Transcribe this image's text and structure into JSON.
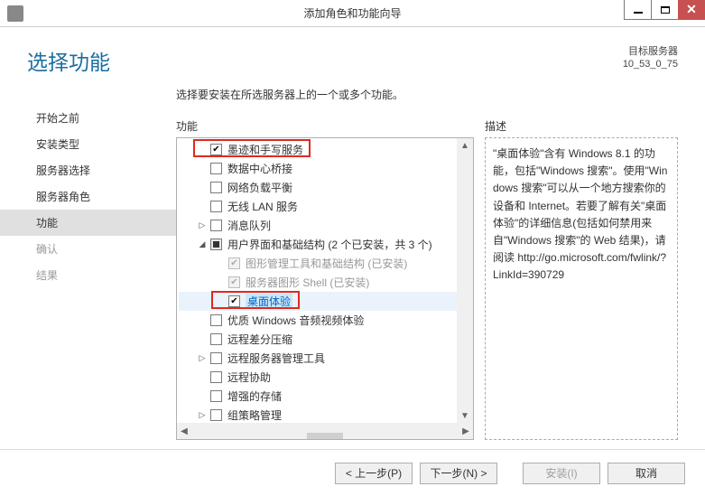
{
  "window": {
    "title": "添加角色和功能向导"
  },
  "header": {
    "title": "选择功能",
    "dest_label": "目标服务器",
    "dest_value": "10_53_0_75"
  },
  "sidebar": {
    "items": [
      {
        "label": "开始之前",
        "active": false,
        "dim": false
      },
      {
        "label": "安装类型",
        "active": false,
        "dim": false
      },
      {
        "label": "服务器选择",
        "active": false,
        "dim": false
      },
      {
        "label": "服务器角色",
        "active": false,
        "dim": false
      },
      {
        "label": "功能",
        "active": true,
        "dim": false
      },
      {
        "label": "确认",
        "active": false,
        "dim": true
      },
      {
        "label": "结果",
        "active": false,
        "dim": true
      }
    ]
  },
  "main": {
    "instruction": "选择要安装在所选服务器上的一个或多个功能。",
    "features_label": "功能",
    "desc_label": "描述",
    "description": "\"桌面体验\"含有 Windows 8.1 的功能，包括\"Windows 搜索\"。使用\"Windows 搜索\"可以从一个地方搜索你的设备和 Internet。若要了解有关\"桌面体验\"的详细信息(包括如何禁用来自\"Windows 搜索\"的 Web 结果)，请阅读 http://go.microsoft.com/fwlink/?LinkId=390729",
    "tree": [
      {
        "label": "墨迹和手写服务",
        "level": 1,
        "checked": true,
        "highlight": true
      },
      {
        "label": "数据中心桥接",
        "level": 1,
        "checked": false
      },
      {
        "label": "网络负载平衡",
        "level": 1,
        "checked": false
      },
      {
        "label": "无线 LAN 服务",
        "level": 1,
        "checked": false
      },
      {
        "label": "消息队列",
        "level": 1,
        "checked": false,
        "expandable": true,
        "expanded": false
      },
      {
        "label": "用户界面和基础结构 (2 个已安装，共 3 个)",
        "level": 1,
        "checked": "partial",
        "expandable": true,
        "expanded": true
      },
      {
        "label": "图形管理工具和基础结构 (已安装)",
        "level": 2,
        "checked": true,
        "disabled": true
      },
      {
        "label": "服务器图形 Shell (已安装)",
        "level": 2,
        "checked": true,
        "disabled": true
      },
      {
        "label": "桌面体验",
        "level": 2,
        "checked": true,
        "selected": true,
        "highlight": true
      },
      {
        "label": "优质 Windows 音频视频体验",
        "level": 1,
        "checked": false
      },
      {
        "label": "远程差分压缩",
        "level": 1,
        "checked": false
      },
      {
        "label": "远程服务器管理工具",
        "level": 1,
        "checked": false,
        "expandable": true,
        "expanded": false
      },
      {
        "label": "远程协助",
        "level": 1,
        "checked": false
      },
      {
        "label": "增强的存储",
        "level": 1,
        "checked": false
      },
      {
        "label": "组策略管理",
        "level": 1,
        "checked": false,
        "expandable": true,
        "expanded": false
      }
    ]
  },
  "footer": {
    "prev": "< 上一步(P)",
    "next": "下一步(N) >",
    "install": "安装(I)",
    "cancel": "取消"
  }
}
